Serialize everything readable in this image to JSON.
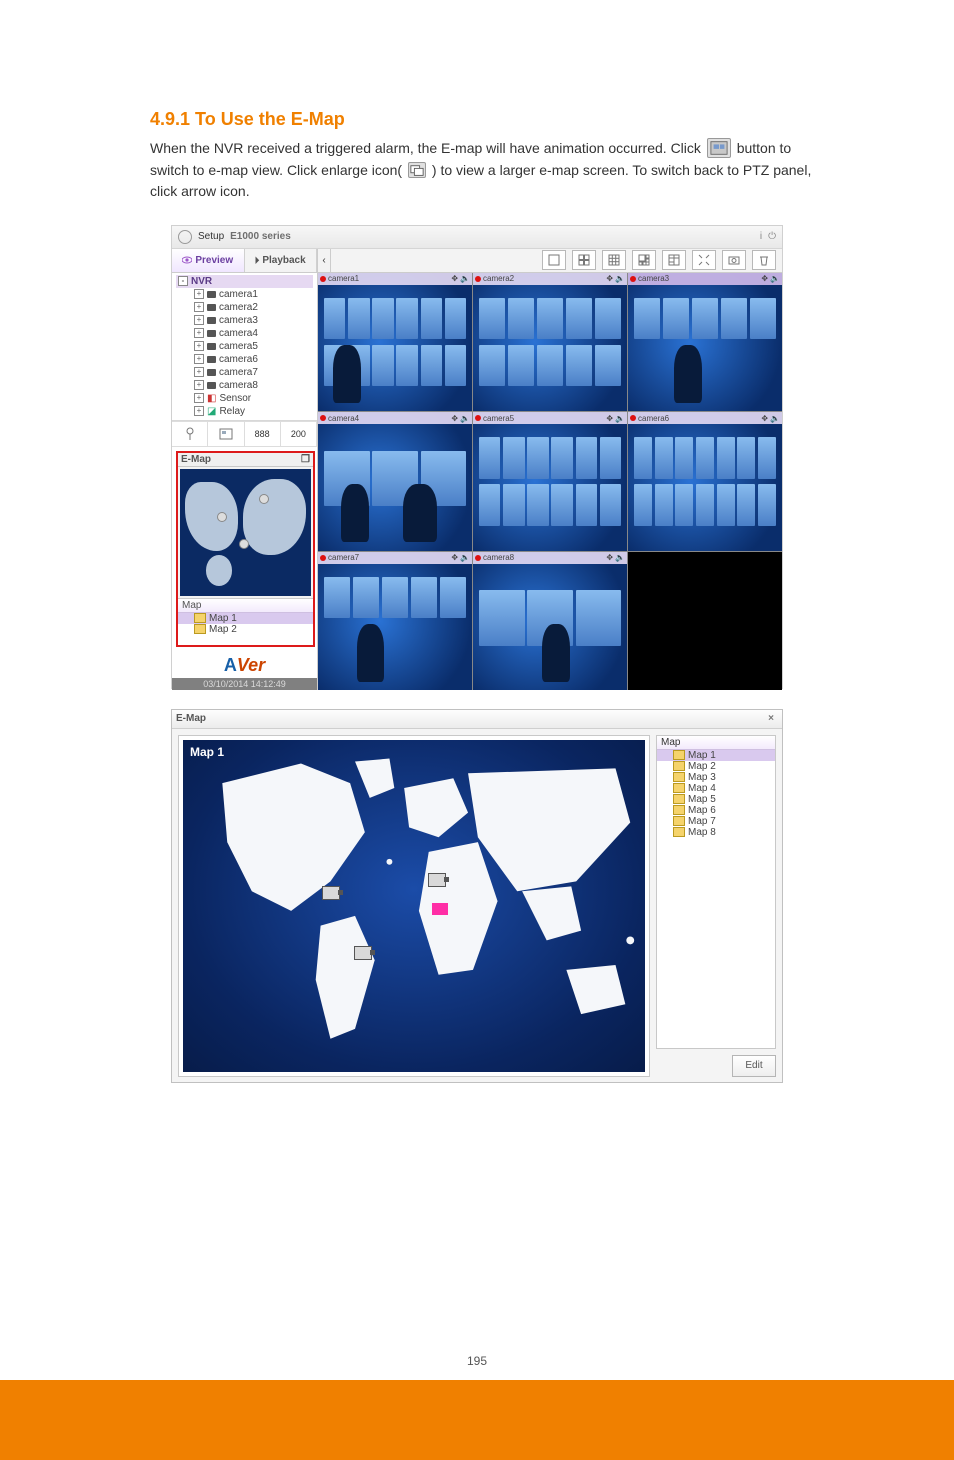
{
  "heading": "4.9.1 To Use the E-Map",
  "paragraph_parts": {
    "p1": "When the NVR received a triggered alarm, the E-map will have animation occurred. Click ",
    "p2": " button to switch to e-map view. Click enlarge icon( ",
    "p3": " ) to view a larger e-map screen. To switch back to PTZ panel, click arrow icon."
  },
  "shot1": {
    "setup_label": "Setup",
    "product_title": "E1000 series",
    "tabs": {
      "preview": "Preview",
      "playback": "Playback"
    },
    "tree_root": "NVR",
    "cameras": [
      "camera1",
      "camera2",
      "camera3",
      "camera4",
      "camera5",
      "camera6",
      "camera7",
      "camera8"
    ],
    "sensor": "Sensor",
    "relay": "Relay",
    "emap_title": "E-Map",
    "map_list_header": "Map",
    "maps": [
      "Map 1",
      "Map 2"
    ],
    "logo_a": "A",
    "logo_ver": "Ver",
    "timestamp": "03/10/2014 14:12:49",
    "cells": [
      "camera1",
      "camera2",
      "camera3",
      "camera4",
      "camera5",
      "camera6",
      "camera7",
      "camera8"
    ]
  },
  "shot2": {
    "window_title": "E-Map",
    "map_title": "Map 1",
    "list_header": "Map",
    "maps": [
      "Map 1",
      "Map 2",
      "Map 3",
      "Map 4",
      "Map 5",
      "Map 6",
      "Map 7",
      "Map 8"
    ],
    "edit_label": "Edit"
  },
  "page_number": "195"
}
